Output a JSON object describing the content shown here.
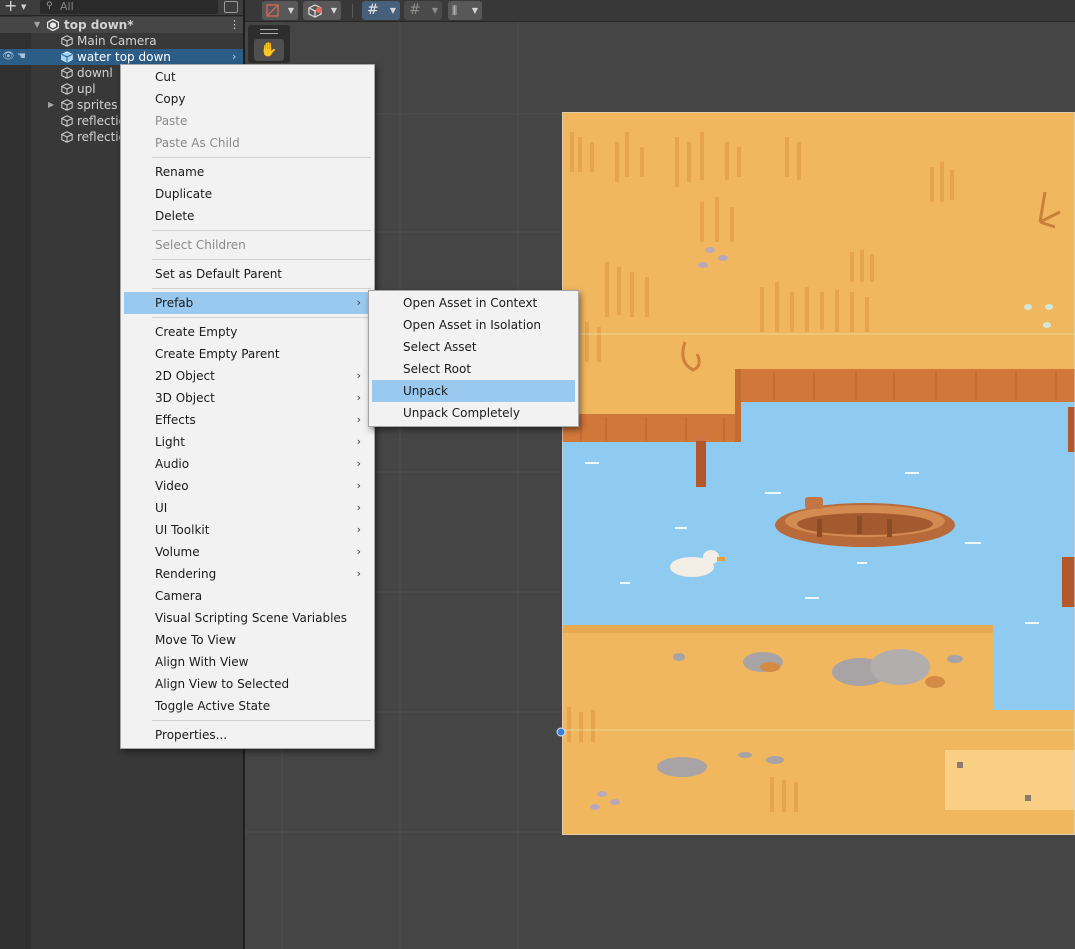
{
  "hierarchy": {
    "search_placeholder": "All",
    "add_label": "+",
    "scene_name": "top down*",
    "rows": [
      {
        "label": "Main Camera"
      },
      {
        "label": "water top down"
      },
      {
        "label": "downl"
      },
      {
        "label": "upl"
      },
      {
        "label": "sprites"
      },
      {
        "label": "reflectio"
      },
      {
        "label": "reflectio"
      }
    ]
  },
  "scene": {
    "hand_tool_glyph": "✋"
  },
  "context_menu": {
    "items": [
      {
        "label": "Cut"
      },
      {
        "label": "Copy"
      },
      {
        "label": "Paste"
      },
      {
        "label": "Paste As Child"
      },
      {
        "label": "Rename"
      },
      {
        "label": "Duplicate"
      },
      {
        "label": "Delete"
      },
      {
        "label": "Select Children"
      },
      {
        "label": "Set as Default Parent"
      },
      {
        "label": "Prefab"
      },
      {
        "label": "Create Empty"
      },
      {
        "label": "Create Empty Parent"
      },
      {
        "label": "2D Object"
      },
      {
        "label": "3D Object"
      },
      {
        "label": "Effects"
      },
      {
        "label": "Light"
      },
      {
        "label": "Audio"
      },
      {
        "label": "Video"
      },
      {
        "label": "UI"
      },
      {
        "label": "UI Toolkit"
      },
      {
        "label": "Volume"
      },
      {
        "label": "Rendering"
      },
      {
        "label": "Camera"
      },
      {
        "label": "Visual Scripting Scene Variables"
      },
      {
        "label": "Move To View"
      },
      {
        "label": "Align With View"
      },
      {
        "label": "Align View to Selected"
      },
      {
        "label": "Toggle Active State"
      },
      {
        "label": "Properties..."
      }
    ]
  },
  "prefab_submenu": {
    "items": [
      {
        "label": "Open Asset in Context"
      },
      {
        "label": "Open Asset in Isolation"
      },
      {
        "label": "Select Asset"
      },
      {
        "label": "Select Root"
      },
      {
        "label": "Unpack"
      },
      {
        "label": "Unpack Completely"
      }
    ]
  }
}
